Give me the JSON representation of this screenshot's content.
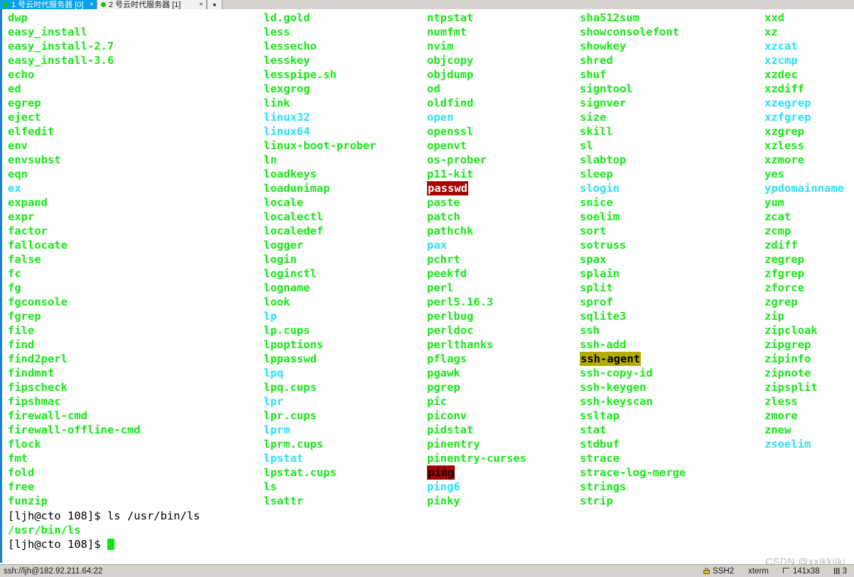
{
  "window": {
    "tabs": [
      {
        "label": "1 号云时代服务器 [0]",
        "active": true,
        "close_glyph": "×"
      },
      {
        "label": "2 号云时代服务器 [1]",
        "active": false,
        "close_glyph": "×"
      }
    ],
    "new_tab_glyph": "▪"
  },
  "statusbar": {
    "connection": "ssh://ljh@182.92.211.64:22",
    "protocol": "SSH2",
    "term_type": "xterm",
    "size": "141x38",
    "trailing": "3",
    "lock_icon": "lock-icon",
    "size_icon": "screen-size-icon",
    "bars_icon": "signal-bars-icon"
  },
  "watermark": "CSDN @xxjkkjjkj",
  "terminal": {
    "columns": [
      {
        "entries": [
          {
            "name": "dwp",
            "type": "exec"
          },
          {
            "name": "easy_install",
            "type": "exec"
          },
          {
            "name": "easy_install-2.7",
            "type": "exec"
          },
          {
            "name": "easy_install-3.6",
            "type": "exec"
          },
          {
            "name": "echo",
            "type": "exec"
          },
          {
            "name": "ed",
            "type": "exec"
          },
          {
            "name": "egrep",
            "type": "exec"
          },
          {
            "name": "eject",
            "type": "exec"
          },
          {
            "name": "elfedit",
            "type": "exec"
          },
          {
            "name": "env",
            "type": "exec"
          },
          {
            "name": "envsubst",
            "type": "exec"
          },
          {
            "name": "eqn",
            "type": "exec"
          },
          {
            "name": "ex",
            "type": "link"
          },
          {
            "name": "expand",
            "type": "exec"
          },
          {
            "name": "expr",
            "type": "exec"
          },
          {
            "name": "factor",
            "type": "exec"
          },
          {
            "name": "fallocate",
            "type": "exec"
          },
          {
            "name": "false",
            "type": "exec"
          },
          {
            "name": "fc",
            "type": "exec"
          },
          {
            "name": "fg",
            "type": "exec"
          },
          {
            "name": "fgconsole",
            "type": "exec"
          },
          {
            "name": "fgrep",
            "type": "exec"
          },
          {
            "name": "file",
            "type": "exec"
          },
          {
            "name": "find",
            "type": "exec"
          },
          {
            "name": "find2perl",
            "type": "exec"
          },
          {
            "name": "findmnt",
            "type": "exec"
          },
          {
            "name": "fipscheck",
            "type": "exec"
          },
          {
            "name": "fipshmac",
            "type": "exec"
          },
          {
            "name": "firewall-cmd",
            "type": "exec"
          },
          {
            "name": "firewall-offline-cmd",
            "type": "exec"
          },
          {
            "name": "flock",
            "type": "exec"
          },
          {
            "name": "fmt",
            "type": "exec"
          },
          {
            "name": "fold",
            "type": "exec"
          },
          {
            "name": "free",
            "type": "exec"
          },
          {
            "name": "funzip",
            "type": "exec"
          }
        ]
      },
      {
        "entries": [
          {
            "name": "ld.gold",
            "type": "exec"
          },
          {
            "name": "less",
            "type": "exec"
          },
          {
            "name": "lessecho",
            "type": "exec"
          },
          {
            "name": "lesskey",
            "type": "exec"
          },
          {
            "name": "lesspipe.sh",
            "type": "exec"
          },
          {
            "name": "lexgrog",
            "type": "exec"
          },
          {
            "name": "link",
            "type": "exec"
          },
          {
            "name": "linux32",
            "type": "link"
          },
          {
            "name": "linux64",
            "type": "link"
          },
          {
            "name": "linux-boot-prober",
            "type": "exec"
          },
          {
            "name": "ln",
            "type": "exec"
          },
          {
            "name": "loadkeys",
            "type": "exec"
          },
          {
            "name": "loadunimap",
            "type": "exec"
          },
          {
            "name": "locale",
            "type": "exec"
          },
          {
            "name": "localectl",
            "type": "exec"
          },
          {
            "name": "localedef",
            "type": "exec"
          },
          {
            "name": "logger",
            "type": "exec"
          },
          {
            "name": "login",
            "type": "exec"
          },
          {
            "name": "loginctl",
            "type": "exec"
          },
          {
            "name": "logname",
            "type": "exec"
          },
          {
            "name": "look",
            "type": "exec"
          },
          {
            "name": "lp",
            "type": "link"
          },
          {
            "name": "lp.cups",
            "type": "exec"
          },
          {
            "name": "lpoptions",
            "type": "exec"
          },
          {
            "name": "lppasswd",
            "type": "exec"
          },
          {
            "name": "lpq",
            "type": "link"
          },
          {
            "name": "lpq.cups",
            "type": "exec"
          },
          {
            "name": "lpr",
            "type": "link"
          },
          {
            "name": "lpr.cups",
            "type": "exec"
          },
          {
            "name": "lprm",
            "type": "link"
          },
          {
            "name": "lprm.cups",
            "type": "exec"
          },
          {
            "name": "lpstat",
            "type": "link"
          },
          {
            "name": "lpstat.cups",
            "type": "exec"
          },
          {
            "name": "ls",
            "type": "exec"
          },
          {
            "name": "lsattr",
            "type": "exec"
          }
        ]
      },
      {
        "entries": [
          {
            "name": "ntpstat",
            "type": "exec"
          },
          {
            "name": "numfmt",
            "type": "exec"
          },
          {
            "name": "nvim",
            "type": "exec"
          },
          {
            "name": "objcopy",
            "type": "exec"
          },
          {
            "name": "objdump",
            "type": "exec"
          },
          {
            "name": "od",
            "type": "exec"
          },
          {
            "name": "oldfind",
            "type": "exec"
          },
          {
            "name": "open",
            "type": "link"
          },
          {
            "name": "openssl",
            "type": "exec"
          },
          {
            "name": "openvt",
            "type": "exec"
          },
          {
            "name": "os-prober",
            "type": "exec"
          },
          {
            "name": "p11-kit",
            "type": "exec"
          },
          {
            "name": "passwd",
            "type": "setuid"
          },
          {
            "name": "paste",
            "type": "exec"
          },
          {
            "name": "patch",
            "type": "exec"
          },
          {
            "name": "pathchk",
            "type": "exec"
          },
          {
            "name": "pax",
            "type": "link"
          },
          {
            "name": "pchrt",
            "type": "exec"
          },
          {
            "name": "peekfd",
            "type": "exec"
          },
          {
            "name": "perl",
            "type": "exec"
          },
          {
            "name": "perl5.16.3",
            "type": "exec"
          },
          {
            "name": "perlbug",
            "type": "exec"
          },
          {
            "name": "perldoc",
            "type": "exec"
          },
          {
            "name": "perlthanks",
            "type": "exec"
          },
          {
            "name": "pflags",
            "type": "exec"
          },
          {
            "name": "pgawk",
            "type": "exec"
          },
          {
            "name": "pgrep",
            "type": "exec"
          },
          {
            "name": "pic",
            "type": "exec"
          },
          {
            "name": "piconv",
            "type": "exec"
          },
          {
            "name": "pidstat",
            "type": "exec"
          },
          {
            "name": "pinentry",
            "type": "exec"
          },
          {
            "name": "pinentry-curses",
            "type": "exec"
          },
          {
            "name": "ping",
            "type": "cap"
          },
          {
            "name": "ping6",
            "type": "link"
          },
          {
            "name": "pinky",
            "type": "exec"
          }
        ]
      },
      {
        "entries": [
          {
            "name": "sha512sum",
            "type": "exec"
          },
          {
            "name": "showconsolefont",
            "type": "exec"
          },
          {
            "name": "showkey",
            "type": "exec"
          },
          {
            "name": "shred",
            "type": "exec"
          },
          {
            "name": "shuf",
            "type": "exec"
          },
          {
            "name": "signtool",
            "type": "exec"
          },
          {
            "name": "signver",
            "type": "exec"
          },
          {
            "name": "size",
            "type": "exec"
          },
          {
            "name": "skill",
            "type": "exec"
          },
          {
            "name": "sl",
            "type": "exec"
          },
          {
            "name": "slabtop",
            "type": "exec"
          },
          {
            "name": "sleep",
            "type": "exec"
          },
          {
            "name": "slogin",
            "type": "link"
          },
          {
            "name": "snice",
            "type": "exec"
          },
          {
            "name": "soelim",
            "type": "exec"
          },
          {
            "name": "sort",
            "type": "exec"
          },
          {
            "name": "sotruss",
            "type": "exec"
          },
          {
            "name": "spax",
            "type": "exec"
          },
          {
            "name": "splain",
            "type": "exec"
          },
          {
            "name": "split",
            "type": "exec"
          },
          {
            "name": "sprof",
            "type": "exec"
          },
          {
            "name": "sqlite3",
            "type": "exec"
          },
          {
            "name": "ssh",
            "type": "exec"
          },
          {
            "name": "ssh-add",
            "type": "exec"
          },
          {
            "name": "ssh-agent",
            "type": "setgid"
          },
          {
            "name": "ssh-copy-id",
            "type": "exec"
          },
          {
            "name": "ssh-keygen",
            "type": "exec"
          },
          {
            "name": "ssh-keyscan",
            "type": "exec"
          },
          {
            "name": "ssltap",
            "type": "exec"
          },
          {
            "name": "stat",
            "type": "exec"
          },
          {
            "name": "stdbuf",
            "type": "exec"
          },
          {
            "name": "strace",
            "type": "exec"
          },
          {
            "name": "strace-log-merge",
            "type": "exec"
          },
          {
            "name": "strings",
            "type": "exec"
          },
          {
            "name": "strip",
            "type": "exec"
          }
        ]
      },
      {
        "entries": [
          {
            "name": "xxd",
            "type": "exec"
          },
          {
            "name": "xz",
            "type": "exec"
          },
          {
            "name": "xzcat",
            "type": "link"
          },
          {
            "name": "xzcmp",
            "type": "link"
          },
          {
            "name": "xzdec",
            "type": "exec"
          },
          {
            "name": "xzdiff",
            "type": "exec"
          },
          {
            "name": "xzegrep",
            "type": "link"
          },
          {
            "name": "xzfgrep",
            "type": "link"
          },
          {
            "name": "xzgrep",
            "type": "exec"
          },
          {
            "name": "xzless",
            "type": "exec"
          },
          {
            "name": "xzmore",
            "type": "exec"
          },
          {
            "name": "yes",
            "type": "exec"
          },
          {
            "name": "ypdomainname",
            "type": "link"
          },
          {
            "name": "yum",
            "type": "exec"
          },
          {
            "name": "zcat",
            "type": "exec"
          },
          {
            "name": "zcmp",
            "type": "exec"
          },
          {
            "name": "zdiff",
            "type": "exec"
          },
          {
            "name": "zegrep",
            "type": "exec"
          },
          {
            "name": "zfgrep",
            "type": "exec"
          },
          {
            "name": "zforce",
            "type": "exec"
          },
          {
            "name": "zgrep",
            "type": "exec"
          },
          {
            "name": "zip",
            "type": "exec"
          },
          {
            "name": "zipcloak",
            "type": "exec"
          },
          {
            "name": "zipgrep",
            "type": "exec"
          },
          {
            "name": "zipinfo",
            "type": "exec"
          },
          {
            "name": "zipnote",
            "type": "exec"
          },
          {
            "name": "zipsplit",
            "type": "exec"
          },
          {
            "name": "zless",
            "type": "exec"
          },
          {
            "name": "zmore",
            "type": "exec"
          },
          {
            "name": "znew",
            "type": "exec"
          },
          {
            "name": "zsoelim",
            "type": "link"
          }
        ]
      }
    ],
    "prompt_lines": [
      {
        "text": "[ljh@cto 108]$ ls /usr/bin/ls",
        "style": "plain",
        "cursor": false
      },
      {
        "text": "/usr/bin/ls",
        "style": "green",
        "cursor": false
      },
      {
        "text": "[ljh@cto 108]$ ",
        "style": "plain",
        "cursor": true
      }
    ]
  }
}
